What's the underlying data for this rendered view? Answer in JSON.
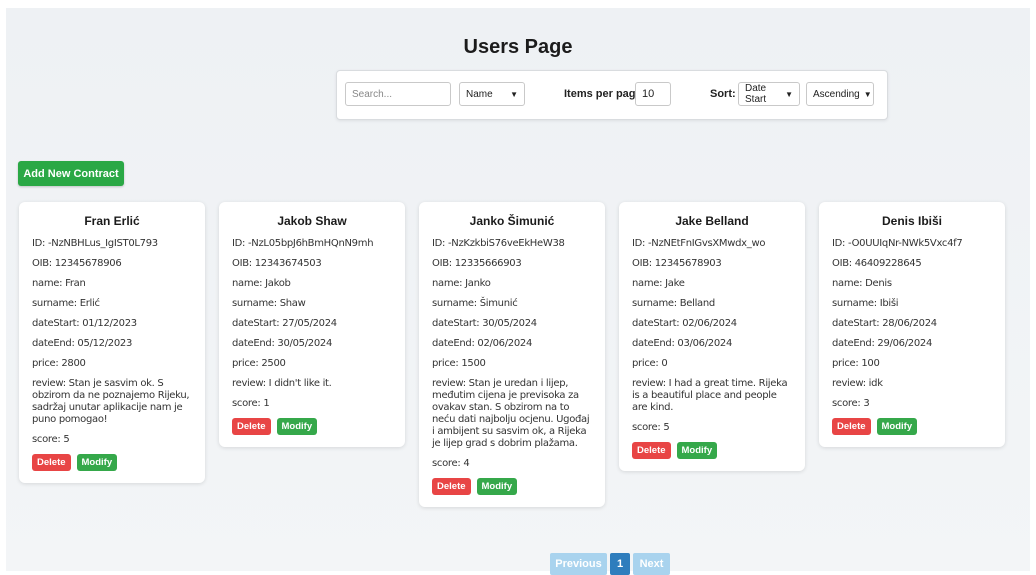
{
  "page": {
    "title": "Users Page"
  },
  "filters": {
    "search_placeholder": "Search...",
    "search_value": "",
    "field_select": "Name",
    "items_per_page_label": "Items per page:",
    "items_per_page_value": "10",
    "sort_label": "Sort:",
    "sort_field": "Date Start",
    "sort_order": "Ascending"
  },
  "toolbar": {
    "add_label": "Add New Contract"
  },
  "cards": [
    {
      "name": "Fran Erlić",
      "id": "ID: -NzNBHLus_IgIST0L793",
      "oib": "OIB: 12345678906",
      "first": "name: Fran",
      "surname": "surname: Erlić",
      "date_start": "dateStart: 01/12/2023",
      "date_end": "dateEnd: 05/12/2023",
      "price": "price: 2800",
      "review": "review: Stan je sasvim ok. S obzirom da ne poznajemo Rijeku, sadržaj unutar aplikacije nam je puno pomogao!",
      "score": "score: 5"
    },
    {
      "name": "Jakob Shaw",
      "id": "ID: -NzL05bpJ6hBmHQnN9mh",
      "oib": "OIB: 12343674503",
      "first": "name: Jakob",
      "surname": "surname: Shaw",
      "date_start": "dateStart: 27/05/2024",
      "date_end": "dateEnd: 30/05/2024",
      "price": "price: 2500",
      "review": "review: I didn't like it.",
      "score": "score: 1"
    },
    {
      "name": "Janko Šimunić",
      "id": "ID: -NzKzkbiS76veEkHeW38",
      "oib": "OIB: 12335666903",
      "first": "name: Janko",
      "surname": "surname: Šimunić",
      "date_start": "dateStart: 30/05/2024",
      "date_end": "dateEnd: 02/06/2024",
      "price": "price: 1500",
      "review": "review: Stan je uredan i lijep, međutim cijena je previsoka za ovakav stan. S obzirom na to neću dati najbolju ocjenu. Ugođaj i ambijent su sasvim ok, a Rijeka je lijep grad s dobrim plažama.",
      "score": "score: 4"
    },
    {
      "name": "Jake Belland",
      "id": "ID: -NzNEtFnIGvsXMwdx_wo",
      "oib": "OIB: 12345678903",
      "first": "name: Jake",
      "surname": "surname: Belland",
      "date_start": "dateStart: 02/06/2024",
      "date_end": "dateEnd: 03/06/2024",
      "price": "price: 0",
      "review": "review: I had a great time. Rijeka is a beautiful place and people are kind.",
      "score": "score: 5"
    },
    {
      "name": "Denis Ibiši",
      "id": "ID: -O0UUIqNr-NWk5Vxc4f7",
      "oib": "OIB: 46409228645",
      "first": "name: Denis",
      "surname": "surname: Ibiši",
      "date_start": "dateStart: 28/06/2024",
      "date_end": "dateEnd: 29/06/2024",
      "price": "price: 100",
      "review": "review: idk",
      "score": "score: 3"
    }
  ],
  "card_actions": {
    "delete_label": "Delete",
    "modify_label": "Modify"
  },
  "pagination": {
    "prev_label": "Previous",
    "current_page": "1",
    "next_label": "Next"
  },
  "colors": {
    "add": "#2aa845",
    "delete": "#e84545",
    "modify": "#35a84a",
    "page_active": "#2e7dbd",
    "page_disabled": "#a9d3ee"
  }
}
